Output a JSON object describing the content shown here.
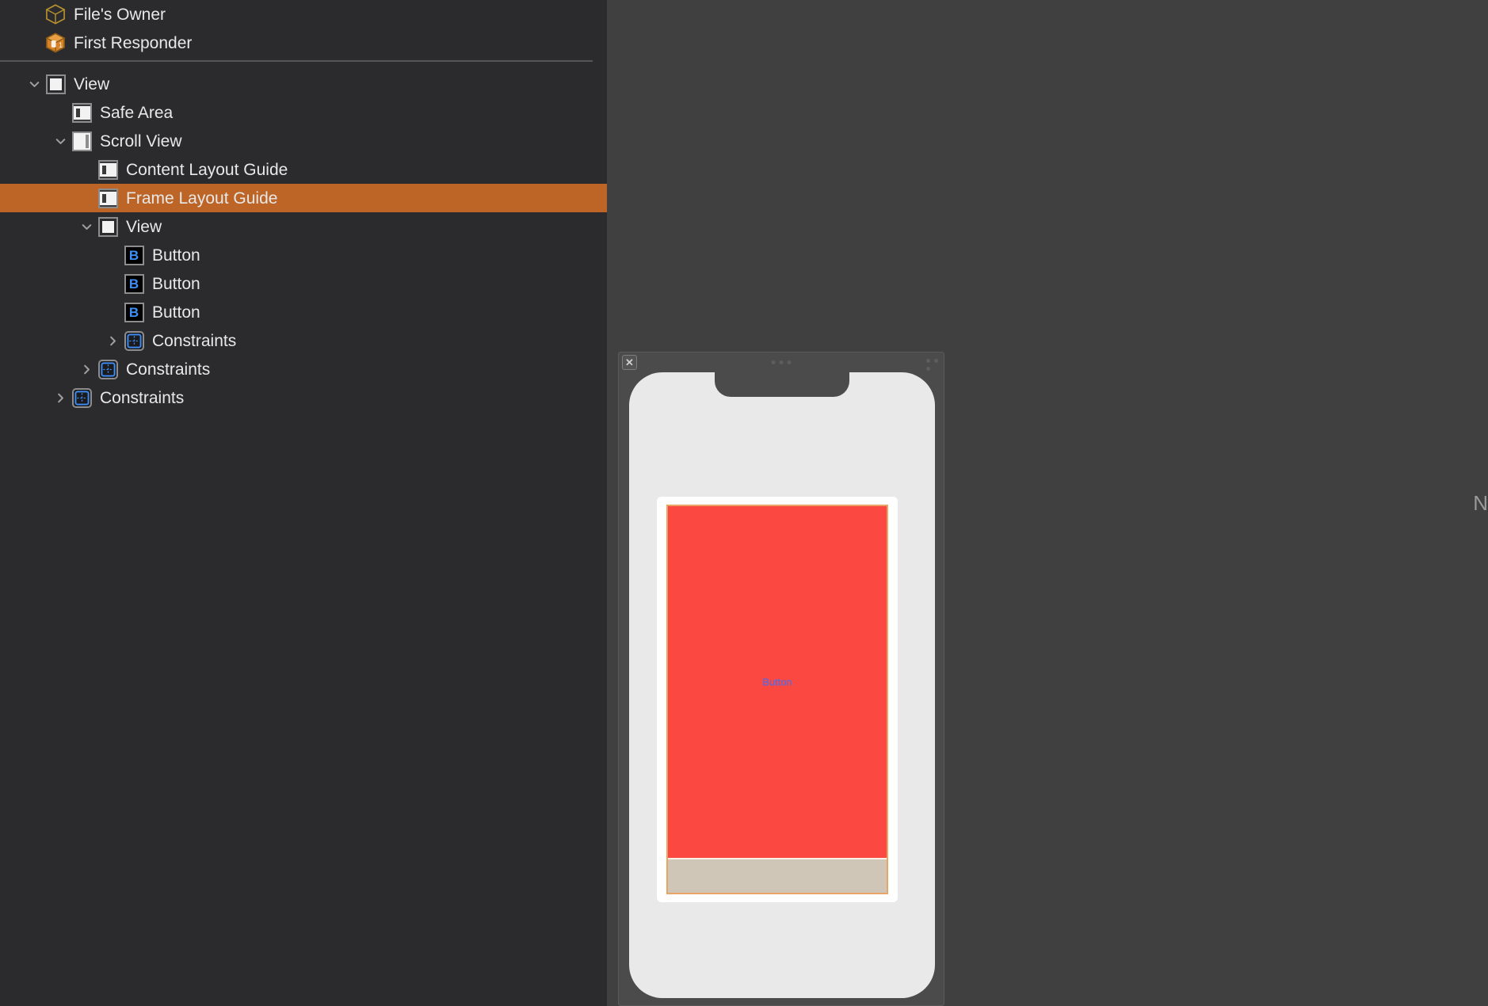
{
  "outline": {
    "rows": [
      {
        "label": "File's Owner",
        "icon": "cube-outline-icon",
        "indent": 0,
        "disclosure": "none",
        "selected": false
      },
      {
        "label": "First Responder",
        "icon": "cube-solid-icon",
        "indent": 0,
        "disclosure": "none",
        "selected": false
      },
      {
        "label": "View",
        "icon": "view-icon",
        "indent": 0,
        "disclosure": "expanded",
        "selected": false
      },
      {
        "label": "Safe Area",
        "icon": "layout-guide-icon",
        "indent": 1,
        "disclosure": "none",
        "selected": false
      },
      {
        "label": "Scroll View",
        "icon": "scroll-view-icon",
        "indent": 1,
        "disclosure": "expanded",
        "selected": false
      },
      {
        "label": "Content Layout Guide",
        "icon": "layout-guide-icon",
        "indent": 2,
        "disclosure": "none",
        "selected": false
      },
      {
        "label": "Frame Layout Guide",
        "icon": "layout-guide-icon",
        "indent": 2,
        "disclosure": "none",
        "selected": true
      },
      {
        "label": "View",
        "icon": "view-icon",
        "indent": 2,
        "disclosure": "expanded",
        "selected": false
      },
      {
        "label": "Button",
        "icon": "button-icon",
        "indent": 3,
        "disclosure": "none",
        "selected": false
      },
      {
        "label": "Button",
        "icon": "button-icon",
        "indent": 3,
        "disclosure": "none",
        "selected": false
      },
      {
        "label": "Button",
        "icon": "button-icon",
        "indent": 3,
        "disclosure": "none",
        "selected": false
      },
      {
        "label": "Constraints",
        "icon": "constraints-icon",
        "indent": 3,
        "disclosure": "collapsed",
        "selected": false
      },
      {
        "label": "Constraints",
        "icon": "constraints-icon",
        "indent": 2,
        "disclosure": "collapsed",
        "selected": false
      },
      {
        "label": "Constraints",
        "icon": "constraints-icon",
        "indent": 1,
        "disclosure": "collapsed",
        "selected": false
      }
    ]
  },
  "canvas": {
    "close_badge_label": "✕",
    "button_label": "Button",
    "edge_text": "N"
  },
  "colors": {
    "panel_background": "#2b2b2d",
    "canvas_background": "#404040",
    "selection": "#bc6527",
    "button_icon_letter": "#3e8ef7",
    "constraint_blue": "#3e8ef7",
    "content_red": "#fb4840",
    "content_tan": "#cfc6b8",
    "scrollview_border": "#e8a565",
    "button_text_blue": "#3e6ff7"
  }
}
